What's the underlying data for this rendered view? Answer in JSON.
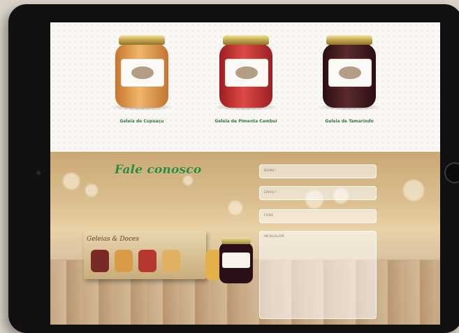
{
  "products": [
    {
      "name": "Geleia de Cupuaçu",
      "jar_color": "#e7a257"
    },
    {
      "name": "Geleia de Pimenta Cambuí",
      "jar_color": "#c9302f"
    },
    {
      "name": "Geleia de Tamarindo",
      "jar_color": "#4a1c20"
    }
  ],
  "contact": {
    "title": "Fale conosco",
    "crate_label": "Geleias & Doces",
    "fields": {
      "nome": "NOME*",
      "email": "EMAIL*",
      "fone": "FONE",
      "mensagem": "MENSAGEM"
    }
  },
  "colors": {
    "accent_green": "#2e8b3a",
    "tablet_frame": "#111111"
  }
}
